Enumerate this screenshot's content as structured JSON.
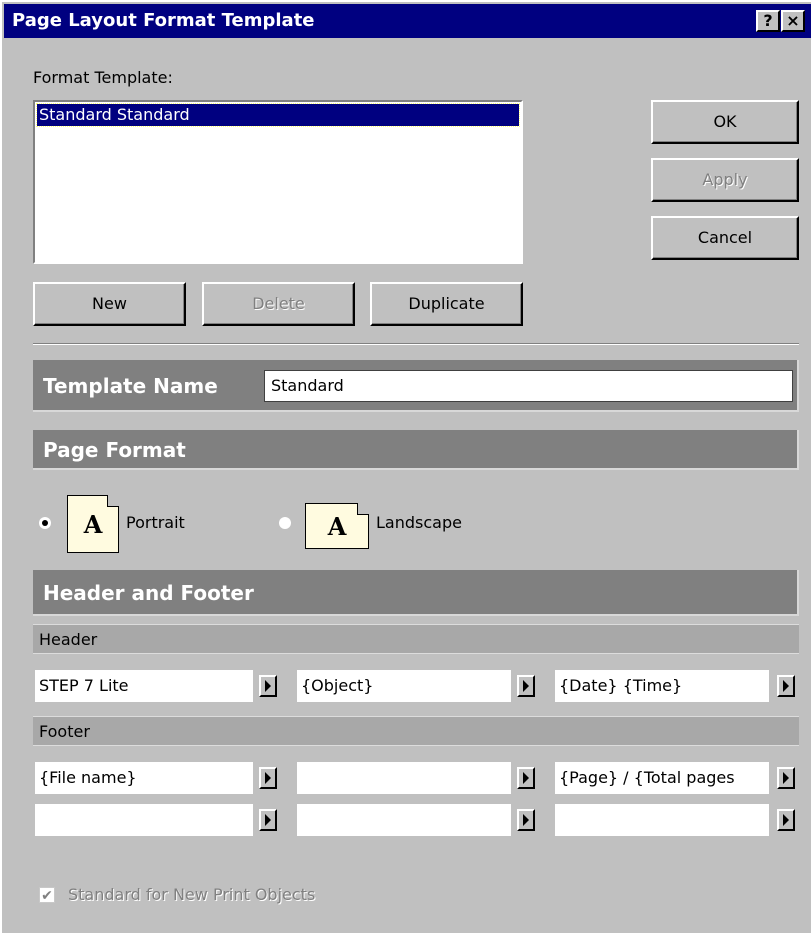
{
  "window": {
    "title": "Page Layout Format Template",
    "help_glyph": "?",
    "close_glyph": "×"
  },
  "format_template": {
    "label": "Format Template:",
    "items": [
      "Standard Standard"
    ]
  },
  "buttons": {
    "ok": "OK",
    "apply": "Apply",
    "cancel": "Cancel",
    "new": "New",
    "delete": "Delete",
    "duplicate": "Duplicate"
  },
  "template_name": {
    "label": "Template Name",
    "value": "Standard"
  },
  "page_format": {
    "label": "Page Format",
    "portrait": "Portrait",
    "landscape": "Landscape",
    "icon_letter": "A",
    "selected": "portrait"
  },
  "header_footer": {
    "label": "Header and Footer",
    "header_label": "Header",
    "footer_label": "Footer",
    "header_fields": [
      "STEP 7 Lite",
      "{Object}",
      "{Date}   {Time}"
    ],
    "footer_row1": [
      "{File name}",
      "",
      "{Page} / {Total pages"
    ],
    "footer_row2": [
      "",
      "",
      ""
    ]
  },
  "standard_checkbox": {
    "label": "Standard for New Print Objects",
    "checked": true,
    "check_glyph": "✔"
  },
  "icons": [
    "help-icon",
    "close-icon",
    "arrow-right-icon",
    "page-portrait-icon",
    "page-landscape-icon",
    "checkmark-icon"
  ]
}
